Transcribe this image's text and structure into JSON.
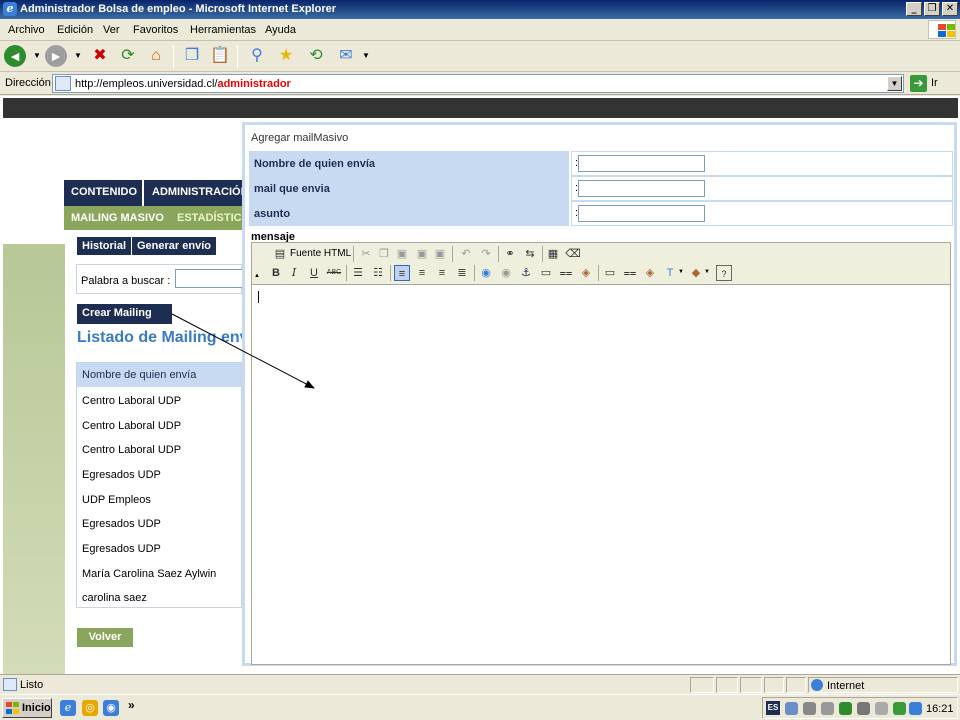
{
  "window": {
    "title": "Administrador Bolsa de empleo - Microsoft Internet Explorer",
    "controls": [
      "_",
      "❐",
      "✕"
    ]
  },
  "menu": [
    "Archivo",
    "Edición",
    "Ver",
    "Favoritos",
    "Herramientas",
    "Ayuda"
  ],
  "address": {
    "label": "Dirección",
    "url_prefix": "http://empleos.universidad.cl/",
    "url_highlight": "administrador",
    "go_label": "Ir"
  },
  "nav": {
    "tabs": [
      "CONTENIDO",
      "ADMINISTRACIÓN"
    ],
    "subtabs": [
      "MAILING MASIVO",
      "ESTADÍSTICAS"
    ]
  },
  "page": {
    "buttons": {
      "historial": "Historial",
      "generar": "Generar envío",
      "crear": "Crear Mailing",
      "volver": "Volver"
    },
    "search_label": "Palabra a buscar :",
    "listing_title": "Listado de Mailing enviados",
    "list_header": "Nombre de quien envía",
    "rows": [
      "Centro Laboral UDP",
      "Centro Laboral UDP",
      "Centro Laboral UDP",
      "Egresados UDP",
      "UDP Empleos",
      "Egresados UDP",
      "Egresados UDP",
      "María Carolina Saez Aylwin",
      "carolina saez"
    ]
  },
  "modal": {
    "title": "Agregar mailMasivo",
    "fields": [
      {
        "label": "Nombre de quien envía",
        "value": ""
      },
      {
        "label": "mail que envia",
        "value": ""
      },
      {
        "label": "asunto",
        "value": ""
      }
    ],
    "colon": ":",
    "message_label": "mensaje",
    "editor": {
      "source_label": "Fuente HTML"
    }
  },
  "status": {
    "text": "Listo",
    "zone": "Internet"
  },
  "taskbar": {
    "start": "Inicio",
    "more": "»",
    "lang": "ES",
    "clock": "16:21"
  },
  "colors": {
    "navy": "#1d2e52",
    "green": "#8aa65c",
    "light_blue": "#c7daf2",
    "title_blue": "#3a7ac0"
  }
}
